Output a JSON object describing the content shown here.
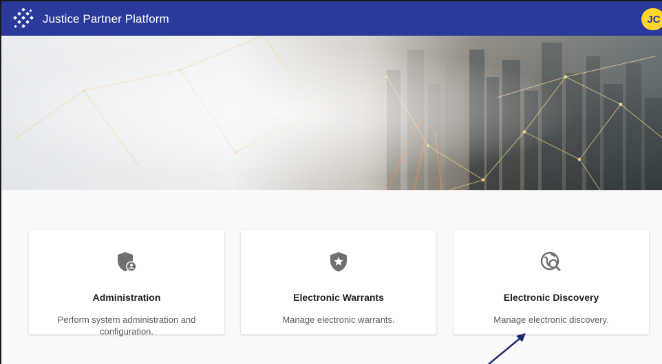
{
  "header": {
    "app_title": "Justice Partner Platform",
    "user_initials": "JC",
    "colors": {
      "bar": "#2b3a9a",
      "avatar": "#ffd629"
    },
    "icons": [
      "logo-icon",
      "moon-icon"
    ]
  },
  "hero": {
    "icon": "city-network-banner"
  },
  "cards": [
    {
      "title": "Administration",
      "description": "Perform system administration and configuration.",
      "icon": "shield-user-icon"
    },
    {
      "title": "Electronic Warrants",
      "description": "Manage electronic warrants.",
      "icon": "shield-star-icon"
    },
    {
      "title": "Electronic Discovery",
      "description": "Manage electronic discovery.",
      "icon": "globe-search-icon"
    }
  ],
  "annotation": {
    "icon": "arrow-pointer-icon",
    "color": "#1e2a6e"
  }
}
